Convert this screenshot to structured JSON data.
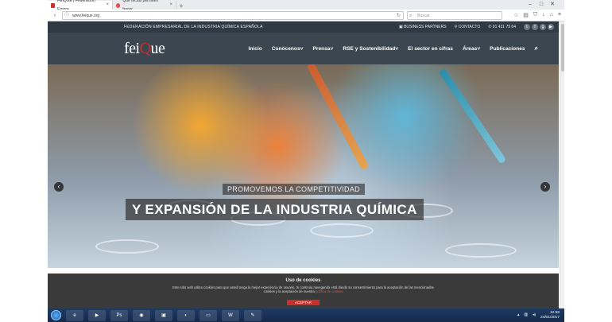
{
  "browser": {
    "tabs": [
      {
        "label": "FEIQUE | Federación Empre...",
        "active": true
      },
      {
        "label": "Qué teclas permiten hacer...",
        "active": false
      }
    ],
    "url": "www.feique.org",
    "search_placeholder": "Buscar"
  },
  "site": {
    "tagline": "FEDERACIÓN EMPRESARIAL DE LA INDUSTRIA QUÍMICA ESPAÑOLA",
    "business_partners": "BUSINESS PARTNERS",
    "contact": "CONTACTO",
    "phone": "91 431 79 64",
    "logo_main": "fei",
    "logo_q": "Q",
    "logo_tail": "ue",
    "menu": [
      "Inicio",
      "Conócenos",
      "Prensa",
      "RSE y Sostenibilidad",
      "El sector en cifras",
      "Áreas",
      "Publicaciones"
    ],
    "hero": {
      "caption_small": "PROMOVEMOS LA COMPETITIVIDAD",
      "caption_big": "Y EXPANSIÓN DE LA INDUSTRIA QUÍMICA"
    }
  },
  "cookie": {
    "title": "Uso de cookies",
    "text": "Este sitio web utiliza cookies para que usted tenga la mejor experiencia de usuario. Si continúa navegando está dando su consentimiento para la aceptación de las mencionadas cookies y la aceptación de nuestra",
    "link": "política de cookies",
    "accept": "ACEPTAR"
  },
  "taskbar": {
    "time": "12:56",
    "date": "24/01/2017"
  },
  "icons": {
    "start": "windows-start-icon",
    "social": [
      "twitter-icon",
      "facebook-icon",
      "googleplus-icon",
      "youtube-icon"
    ]
  }
}
